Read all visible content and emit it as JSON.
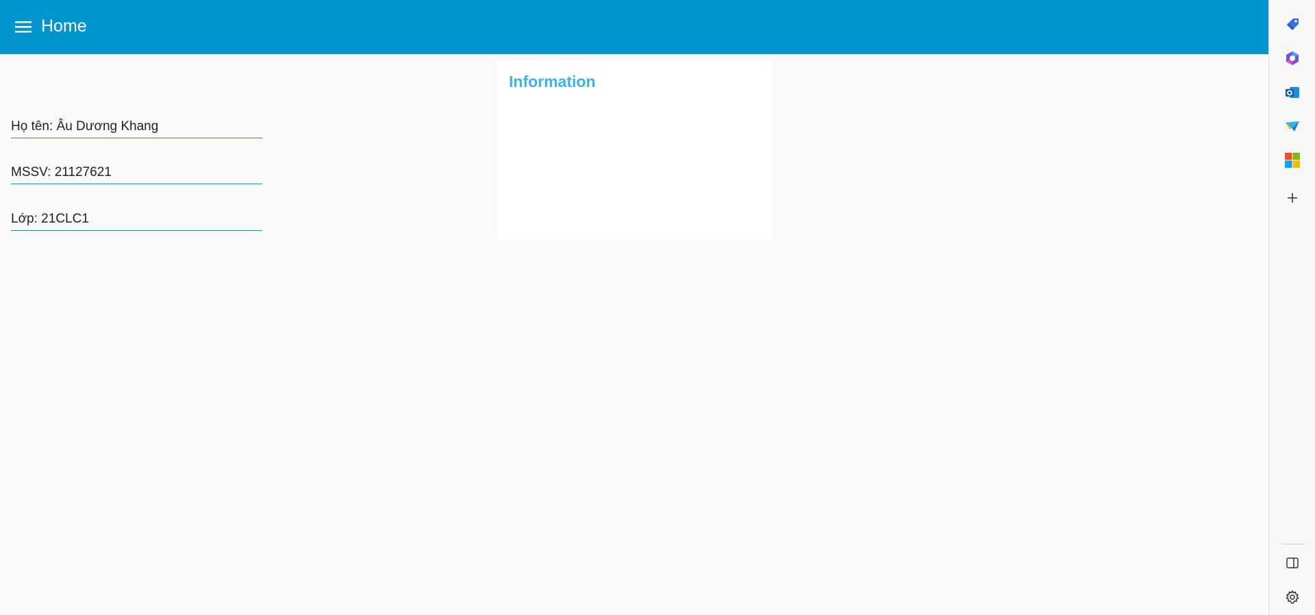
{
  "header": {
    "title": "Home",
    "menu_icon": "hamburger-menu-icon",
    "background_color": "#0194cf"
  },
  "card": {
    "title": "Information",
    "title_color": "#37b5e6",
    "fields": [
      "Họ tên: Âu Dương Khang",
      "MSSV: 21127621",
      "Lớp: 21CLC1"
    ]
  },
  "sidebar": {
    "icons": [
      "tag-icon",
      "copilot-icon",
      "outlook-icon",
      "send-icon",
      "microsoft-365-icon",
      "add-icon",
      "split-screen-icon",
      "settings-icon"
    ]
  }
}
